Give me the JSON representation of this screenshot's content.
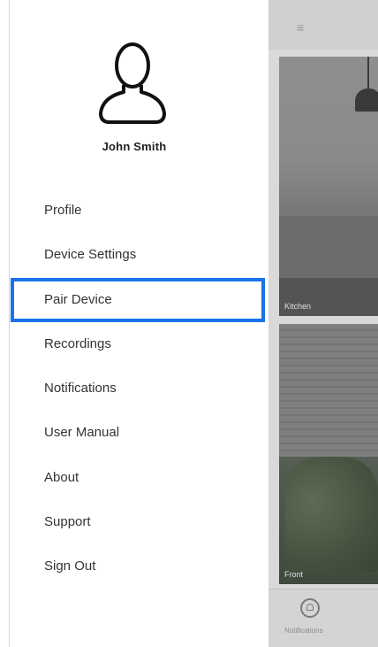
{
  "drawer": {
    "user_name": "John Smith",
    "selected_index": 2,
    "items": [
      {
        "label": "Profile"
      },
      {
        "label": "Device Settings"
      },
      {
        "label": "Pair Device"
      },
      {
        "label": "Recordings"
      },
      {
        "label": "Notifications"
      },
      {
        "label": "User Manual"
      },
      {
        "label": "About"
      },
      {
        "label": "Support"
      },
      {
        "label": "Sign Out"
      }
    ]
  },
  "background_app": {
    "menu_icon": "hamburger-icon",
    "cameras": [
      {
        "label": "Kitchen"
      },
      {
        "label": "Front"
      }
    ],
    "bottom_tab": {
      "icon": "bell-icon",
      "label": "Notifications"
    }
  },
  "colors": {
    "highlight": "#1a73e8"
  }
}
